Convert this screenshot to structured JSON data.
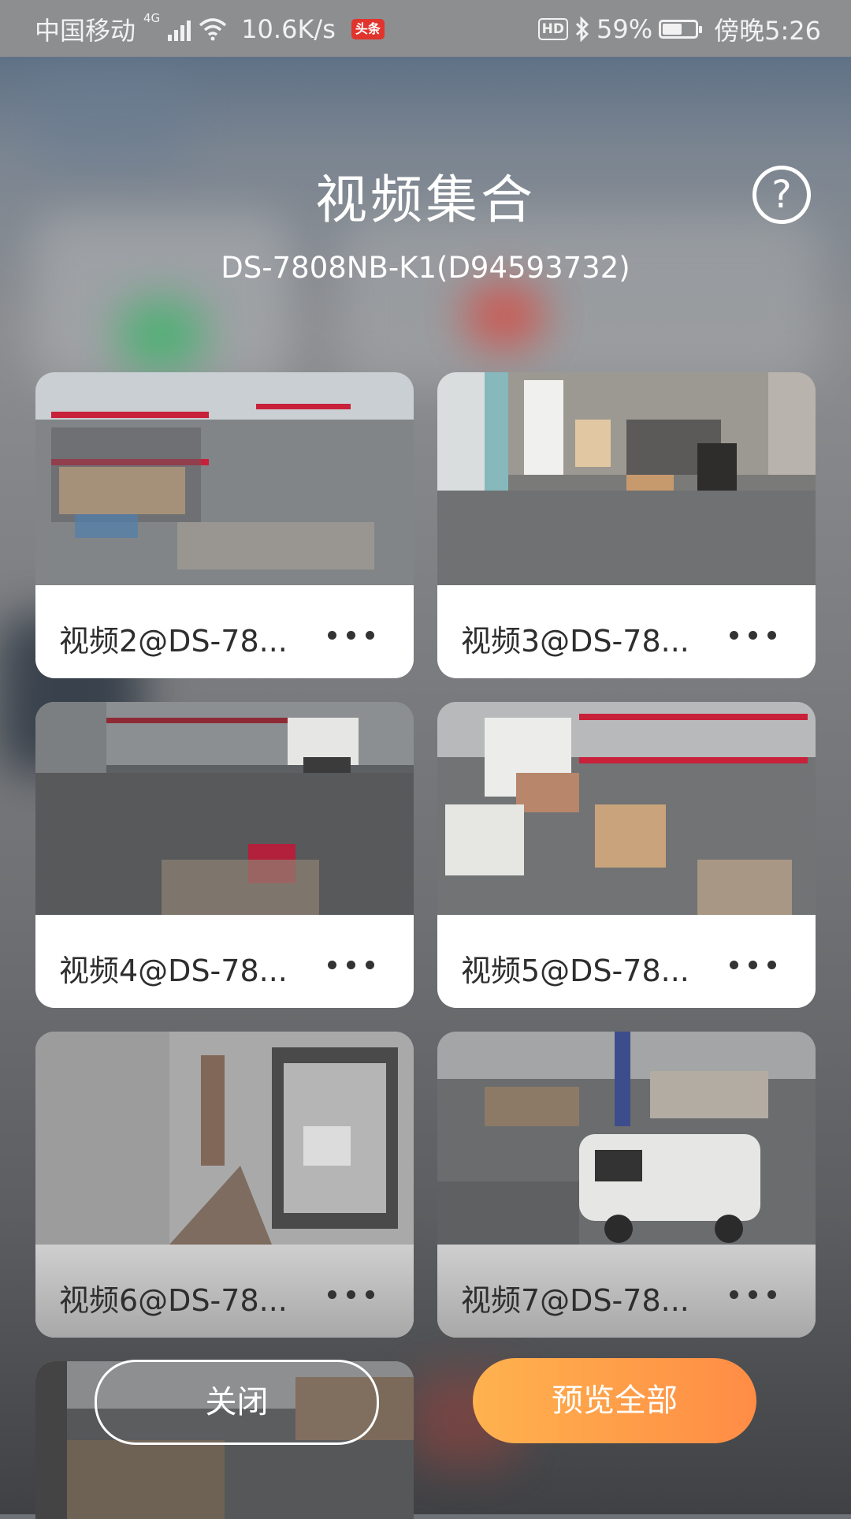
{
  "status_bar": {
    "carrier": "中国移动",
    "network": "4G",
    "speed": "10.6K/s",
    "news_badge": "头条",
    "hd": "HD",
    "battery_percent": "59%",
    "battery_level": 0.59,
    "time": "傍晚5:26"
  },
  "header": {
    "title": "视频集合",
    "help_icon": "question-circle-icon",
    "device": "DS-7808NB-K1(D94593732)"
  },
  "channels": [
    {
      "label": "视频2@DS-78..."
    },
    {
      "label": "视频3@DS-78..."
    },
    {
      "label": "视频4@DS-78..."
    },
    {
      "label": "视频5@DS-78..."
    },
    {
      "label": "视频6@DS-78..."
    },
    {
      "label": "视频7@DS-78..."
    },
    {
      "label": ""
    }
  ],
  "actions": {
    "close": "关闭",
    "preview_all": "预览全部"
  },
  "colors": {
    "accent_start": "#ffb24e",
    "accent_end": "#ff8c45"
  }
}
